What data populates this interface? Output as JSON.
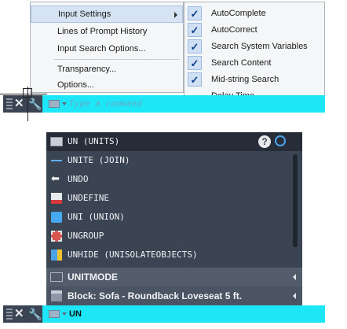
{
  "context_menu": {
    "items": [
      {
        "label": "Input Settings",
        "highlighted": true,
        "has_submenu": true
      },
      {
        "label": "Lines of Prompt History"
      },
      {
        "label": "Input Search Options..."
      },
      {
        "label": "Transparency..."
      },
      {
        "label": "Options..."
      }
    ],
    "submenu": {
      "items": [
        {
          "label": "AutoComplete",
          "checked": true
        },
        {
          "label": "AutoCorrect",
          "checked": true
        },
        {
          "label": "Search System Variables",
          "checked": true
        },
        {
          "label": "Search Content",
          "checked": true
        },
        {
          "label": "Mid-string Search",
          "checked": true
        },
        {
          "label": "Delay Time",
          "checked": false
        }
      ],
      "check_glyph": "✓"
    }
  },
  "top_command_line": {
    "placeholder": "Type a command",
    "close_glyph": "✕",
    "wrench_glyph": "🔧"
  },
  "autocomplete": {
    "rows": [
      {
        "label": "UN (UNITS)",
        "icon": "units-icon",
        "selected": true
      },
      {
        "label": "UNITE (JOIN)",
        "icon": "join-icon"
      },
      {
        "label": "UNDO",
        "icon": "undo-arrow-icon"
      },
      {
        "label": "UNDEFINE",
        "icon": "undefine-icon"
      },
      {
        "label": "UNI (UNION)",
        "icon": "union-icon"
      },
      {
        "label": "UNGROUP",
        "icon": "ungroup-icon"
      },
      {
        "label": "UNHIDE (UNISOLATEOBJECTS)",
        "icon": "unhide-icon"
      },
      {
        "label": "UNITMODE",
        "icon": "sysvar-icon",
        "section": true
      },
      {
        "label": "Block: Sofa - Roundback Loveseat 5 ft.",
        "icon": "block-icon",
        "section": true
      }
    ],
    "help_glyph": "?"
  },
  "bottom_command_line": {
    "value": "UN",
    "close_glyph": "✕",
    "wrench_glyph": "🔧"
  },
  "colors": {
    "command_field": "#1de6f6",
    "panel_dark": "#3b4453",
    "menu_bg": "#f5f6f7"
  }
}
